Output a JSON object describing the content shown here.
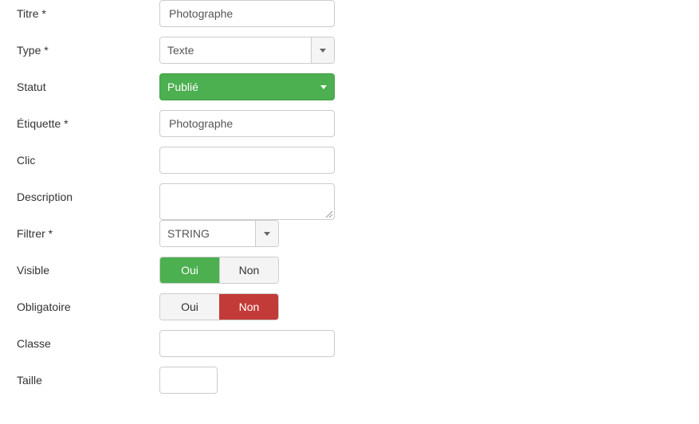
{
  "form": {
    "rows": [
      {
        "label": "Titre *",
        "name": "titre",
        "control": "text",
        "value": "Photographe",
        "placeholder": ""
      },
      {
        "label": "Type *",
        "name": "type",
        "control": "select",
        "value": "Texte",
        "width": "w220"
      },
      {
        "label": "Statut",
        "name": "statut",
        "control": "select-status",
        "value": "Publié",
        "width": "w220"
      },
      {
        "label": "Étiquette *",
        "name": "etiquette",
        "control": "text",
        "value": "Photographe",
        "placeholder": ""
      },
      {
        "label": "Clic",
        "name": "clic",
        "control": "text",
        "value": "",
        "placeholder": ""
      },
      {
        "label": "Description",
        "name": "description",
        "control": "textarea",
        "value": "",
        "placeholder": ""
      },
      {
        "label": "Filtrer *",
        "name": "filtrer",
        "control": "select",
        "value": "STRING",
        "width": "w150"
      },
      {
        "label": "Visible",
        "name": "visible",
        "control": "toggle",
        "yes_label": "Oui",
        "no_label": "Non",
        "selected": "yes"
      },
      {
        "label": "Obligatoire",
        "name": "obligatoire",
        "control": "toggle",
        "yes_label": "Oui",
        "no_label": "Non",
        "selected": "no"
      },
      {
        "label": "Classe",
        "name": "classe",
        "control": "text",
        "value": "",
        "placeholder": ""
      },
      {
        "label": "Taille",
        "name": "taille",
        "control": "text-narrow",
        "value": "",
        "placeholder": ""
      }
    ]
  },
  "colors": {
    "status_green": "#4caf50",
    "toggle_green": "#4caf50",
    "toggle_red": "#c23b38",
    "border": "#cccccc",
    "text": "#333333",
    "input_text": "#555555",
    "button_face": "#f4f4f4"
  },
  "icons": {
    "caret": "chevron-down-icon",
    "resize": "resize-grip-icon"
  }
}
